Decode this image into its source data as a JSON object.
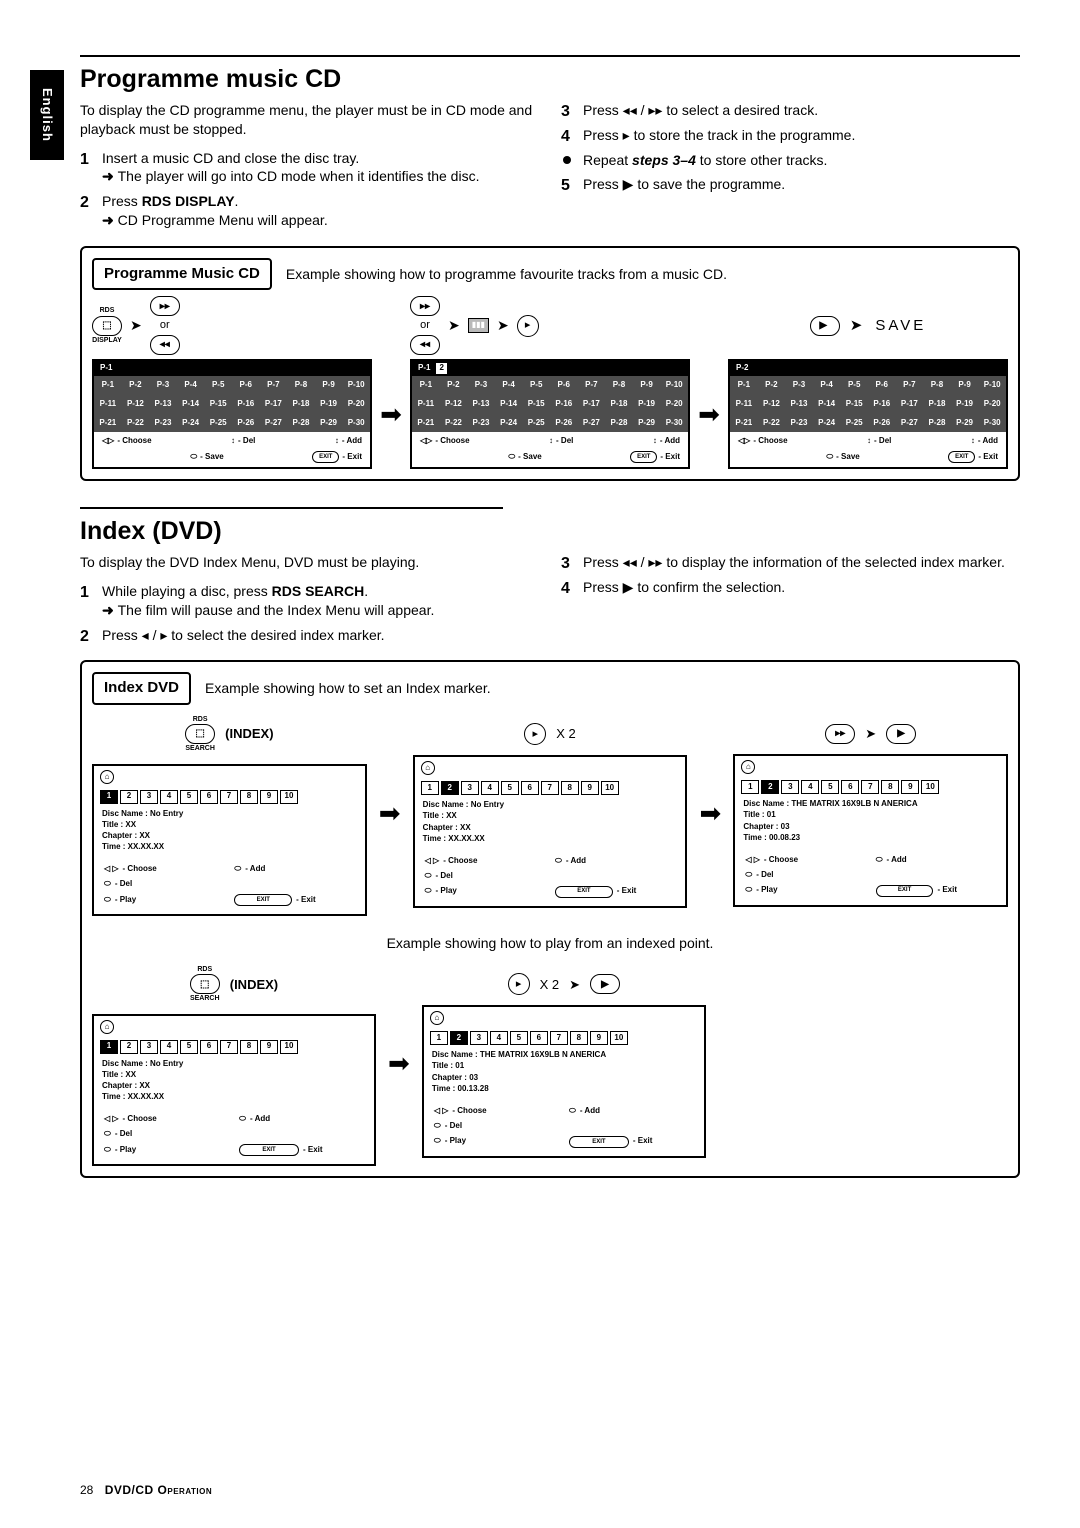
{
  "sidetab": "English",
  "section1": {
    "title": "Programme music CD",
    "intro": "To display the CD programme menu, the player must be in CD mode and playback must be stopped.",
    "left": {
      "s1": "Insert a music CD and close the disc tray.",
      "s1r": "The player will go into CD mode when it identifies the disc.",
      "s2a": "Press ",
      "s2b": "RDS DISPLAY",
      "s2c": ".",
      "s2r": "CD Programme Menu will appear."
    },
    "right": {
      "s3": "Press ◂◂ / ▸▸ to select a desired track.",
      "s4": "Press ▸ to store the track in the programme.",
      "sb": "Repeat ",
      "sbi": "steps 3–4",
      "sbc": " to store other tracks.",
      "s5": "Press ▶ to save the programme."
    },
    "diagram": {
      "title": "Programme Music CD",
      "desc": "Example showing how to programme favourite tracks from a music CD.",
      "or": "or",
      "save": "SAVE",
      "rds_label": "RDS",
      "display_label": "DISPLAY",
      "panel_title_p1": "P-1",
      "panel_title_sel": "2",
      "panel_title_p2": "P-2",
      "pcells": [
        "P-1",
        "P-2",
        "P-3",
        "P-4",
        "P-5",
        "P-6",
        "P-7",
        "P-8",
        "P-9",
        "P-10",
        "P-11",
        "P-12",
        "P-13",
        "P-14",
        "P-15",
        "P-16",
        "P-17",
        "P-18",
        "P-19",
        "P-20",
        "P-21",
        "P-22",
        "P-23",
        "P-24",
        "P-25",
        "P-26",
        "P-27",
        "P-28",
        "P-29",
        "P-30"
      ],
      "foot_choose": "- Choose",
      "foot_del": "- Del",
      "foot_add": "- Add",
      "foot_save": "- Save",
      "foot_exit": "- Exit"
    }
  },
  "section2": {
    "title": "Index (DVD)",
    "intro": "To display the DVD Index Menu, DVD must be playing.",
    "left": {
      "s1a": "While playing a disc, press ",
      "s1b": "RDS SEARCH",
      "s1c": ".",
      "s1r": "The film will pause and the Index Menu will appear.",
      "s2": "Press ◂ / ▸ to select the desired index marker."
    },
    "right": {
      "s3": "Press ◂◂ / ▸▸ to display the information of the selected index marker.",
      "s4": "Press ▶ to confirm the selection."
    },
    "diagram": {
      "title": "Index DVD",
      "desc1": "Example showing how to set an Index marker.",
      "desc2": "Example showing how to play from an indexed point.",
      "index_label": "(INDEX)",
      "rds_label": "RDS",
      "search_label": "SEARCH",
      "x2": "X 2",
      "nums": [
        "1",
        "2",
        "3",
        "4",
        "5",
        "6",
        "7",
        "8",
        "9",
        "10"
      ],
      "info1": {
        "disc": "Disc Name : No Entry",
        "title": "Title : XX",
        "chap": "Chapter : XX",
        "time": "Time : XX.XX.XX"
      },
      "info2": {
        "disc": "Disc Name : No Entry",
        "title": "Title : XX",
        "chap": "Chapter : XX",
        "time": "Time : XX.XX.XX"
      },
      "info3": {
        "disc": "Disc Name : THE MATRIX 16X9LB N ANERICA",
        "title": "Title : 01",
        "chap": "Chapter : 03",
        "time": "Time : 00.08.23"
      },
      "info4": {
        "disc": "Disc Name : No Entry",
        "title": "Title : XX",
        "chap": "Chapter : XX",
        "time": "Time : XX.XX.XX"
      },
      "info5": {
        "disc": "Disc Name : THE MATRIX 16X9LB N ANERICA",
        "title": "Title : 01",
        "chap": "Chapter : 03",
        "time": "Time : 00.13.28"
      },
      "foot_choose": "- Choose",
      "foot_add": "- Add",
      "foot_del": "- Del",
      "foot_play": "- Play",
      "foot_exit": "- Exit"
    }
  },
  "footer": {
    "page": "28",
    "section": "DVD/CD Operation"
  }
}
